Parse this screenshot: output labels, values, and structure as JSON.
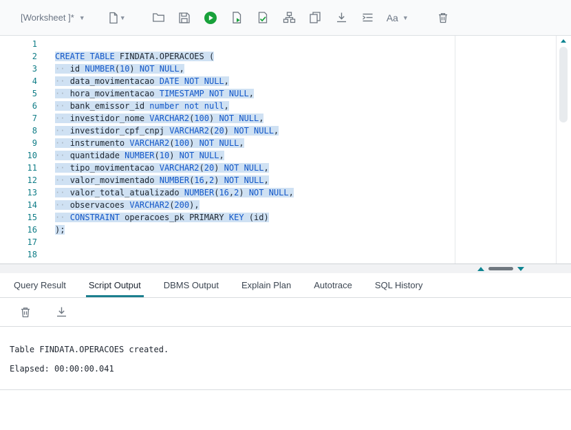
{
  "toolbar": {
    "worksheet_label": "[Worksheet ]*",
    "font_button_label": "Aa",
    "icons": [
      "new-worksheet",
      "open-file",
      "save",
      "run-statement",
      "run-script",
      "autotrace",
      "explain-plan",
      "unshared-worksheet",
      "download",
      "format",
      "font-options",
      "clear-worksheet"
    ]
  },
  "editor": {
    "colors": {
      "keyword": "#1156c8",
      "number": "#1156c8",
      "whitespace": "#a8b3bd",
      "line_number": "#0e7c86",
      "selection": "#cfe1f3",
      "accent": "#1b7f8e",
      "run_green": "#18a13a"
    },
    "lines": [
      {
        "n": "1",
        "sel": false,
        "tokens": []
      },
      {
        "n": "2",
        "sel": true,
        "tokens": [
          [
            "k",
            "CREATE TABLE"
          ],
          [
            "t",
            " FINDATA.OPERACOES ("
          ]
        ]
      },
      {
        "n": "3",
        "sel": true,
        "tokens": [
          [
            "w",
            "·· "
          ],
          [
            "t",
            "id "
          ],
          [
            "k",
            "NUMBER"
          ],
          [
            "t",
            "("
          ],
          [
            "n",
            "10"
          ],
          [
            "t",
            ") "
          ],
          [
            "k",
            "NOT NULL"
          ],
          [
            "t",
            ","
          ]
        ]
      },
      {
        "n": "4",
        "sel": true,
        "tokens": [
          [
            "w",
            "·· "
          ],
          [
            "t",
            "data_movimentacao "
          ],
          [
            "k",
            "DATE NOT NULL"
          ],
          [
            "t",
            ","
          ]
        ]
      },
      {
        "n": "5",
        "sel": true,
        "tokens": [
          [
            "w",
            "·· "
          ],
          [
            "t",
            "hora_movimentacao "
          ],
          [
            "k",
            "TIMESTAMP NOT NULL"
          ],
          [
            "t",
            ","
          ]
        ]
      },
      {
        "n": "6",
        "sel": true,
        "tokens": [
          [
            "w",
            "·· "
          ],
          [
            "t",
            "bank_emissor_id "
          ],
          [
            "k",
            "number not null"
          ],
          [
            "t",
            ","
          ]
        ]
      },
      {
        "n": "7",
        "sel": true,
        "tokens": [
          [
            "w",
            "·· "
          ],
          [
            "t",
            "investidor_nome "
          ],
          [
            "k",
            "VARCHAR2"
          ],
          [
            "t",
            "("
          ],
          [
            "n",
            "100"
          ],
          [
            "t",
            ") "
          ],
          [
            "k",
            "NOT NULL"
          ],
          [
            "t",
            ","
          ]
        ]
      },
      {
        "n": "8",
        "sel": true,
        "tokens": [
          [
            "w",
            "·· "
          ],
          [
            "t",
            "investidor_cpf_cnpj "
          ],
          [
            "k",
            "VARCHAR2"
          ],
          [
            "t",
            "("
          ],
          [
            "n",
            "20"
          ],
          [
            "t",
            ") "
          ],
          [
            "k",
            "NOT NULL"
          ],
          [
            "t",
            ","
          ]
        ]
      },
      {
        "n": "9",
        "sel": true,
        "tokens": [
          [
            "w",
            "·· "
          ],
          [
            "t",
            "instrumento "
          ],
          [
            "k",
            "VARCHAR2"
          ],
          [
            "t",
            "("
          ],
          [
            "n",
            "100"
          ],
          [
            "t",
            ") "
          ],
          [
            "k",
            "NOT NULL"
          ],
          [
            "t",
            ","
          ]
        ]
      },
      {
        "n": "10",
        "sel": true,
        "tokens": [
          [
            "w",
            "·· "
          ],
          [
            "t",
            "quantidade "
          ],
          [
            "k",
            "NUMBER"
          ],
          [
            "t",
            "("
          ],
          [
            "n",
            "10"
          ],
          [
            "t",
            ") "
          ],
          [
            "k",
            "NOT NULL"
          ],
          [
            "t",
            ","
          ]
        ]
      },
      {
        "n": "11",
        "sel": true,
        "tokens": [
          [
            "w",
            "·· "
          ],
          [
            "t",
            "tipo_movimentacao "
          ],
          [
            "k",
            "VARCHAR2"
          ],
          [
            "t",
            "("
          ],
          [
            "n",
            "20"
          ],
          [
            "t",
            ") "
          ],
          [
            "k",
            "NOT NULL"
          ],
          [
            "t",
            ","
          ]
        ]
      },
      {
        "n": "12",
        "sel": true,
        "tokens": [
          [
            "w",
            "·· "
          ],
          [
            "t",
            "valor_movimentado "
          ],
          [
            "k",
            "NUMBER"
          ],
          [
            "t",
            "("
          ],
          [
            "n",
            "16"
          ],
          [
            "t",
            ","
          ],
          [
            "n",
            "2"
          ],
          [
            "t",
            ") "
          ],
          [
            "k",
            "NOT NULL"
          ],
          [
            "t",
            ","
          ]
        ]
      },
      {
        "n": "13",
        "sel": true,
        "tokens": [
          [
            "w",
            "·· "
          ],
          [
            "t",
            "valor_total_atualizado "
          ],
          [
            "k",
            "NUMBER"
          ],
          [
            "t",
            "("
          ],
          [
            "n",
            "16"
          ],
          [
            "t",
            ","
          ],
          [
            "n",
            "2"
          ],
          [
            "t",
            ") "
          ],
          [
            "k",
            "NOT NULL"
          ],
          [
            "t",
            ","
          ]
        ]
      },
      {
        "n": "14",
        "sel": true,
        "tokens": [
          [
            "w",
            "·· "
          ],
          [
            "t",
            "observacoes "
          ],
          [
            "k",
            "VARCHAR2"
          ],
          [
            "t",
            "("
          ],
          [
            "n",
            "200"
          ],
          [
            "t",
            "),"
          ]
        ]
      },
      {
        "n": "15",
        "sel": true,
        "tokens": [
          [
            "w",
            "·· "
          ],
          [
            "k",
            "CONSTRAINT"
          ],
          [
            "t",
            " operacoes_pk PRIMARY "
          ],
          [
            "k",
            "KEY"
          ],
          [
            "t",
            " (id)"
          ]
        ]
      },
      {
        "n": "16",
        "sel": true,
        "tokens": [
          [
            "t",
            ");"
          ]
        ]
      },
      {
        "n": "17",
        "sel": false,
        "tokens": []
      },
      {
        "n": "18",
        "sel": false,
        "tokens": []
      }
    ]
  },
  "results": {
    "tabs": [
      {
        "label": "Query Result",
        "active": false
      },
      {
        "label": "Script Output",
        "active": true
      },
      {
        "label": "DBMS Output",
        "active": false
      },
      {
        "label": "Explain Plan",
        "active": false
      },
      {
        "label": "Autotrace",
        "active": false
      },
      {
        "label": "SQL History",
        "active": false
      }
    ],
    "toolbar_icons": [
      "clear-output",
      "save-output"
    ],
    "output_lines": [
      "Table FINDATA.OPERACOES created.",
      "",
      "Elapsed: 00:00:00.041"
    ]
  }
}
